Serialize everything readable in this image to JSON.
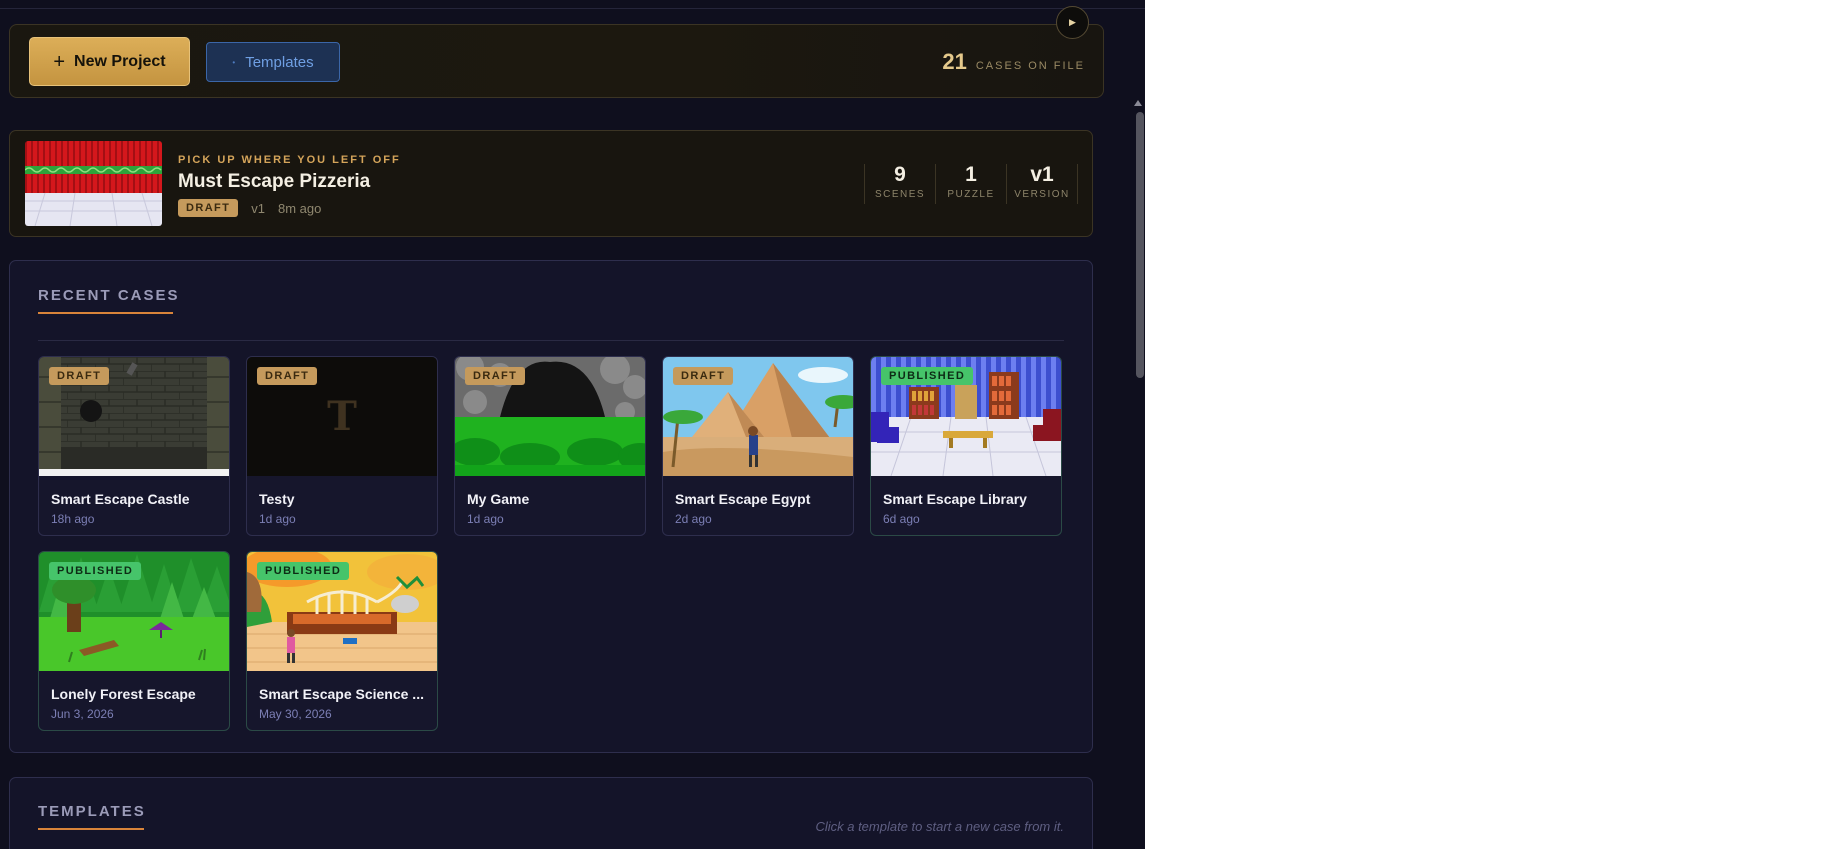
{
  "toolbar": {
    "new_project_label": "New Project",
    "new_project_icon": "plus-icon",
    "templates_label": "Templates",
    "case_count": "21",
    "case_count_label": "CASES ON FILE",
    "play_icon": "play-icon"
  },
  "continue_card": {
    "eyebrow": "PICK UP WHERE YOU LEFT OFF",
    "title": "Must Escape Pizzeria",
    "status": "DRAFT",
    "version": "v1",
    "edited": "8m ago",
    "stats": [
      {
        "value": "9",
        "label": "SCENES"
      },
      {
        "value": "1",
        "label": "PUZZLE"
      },
      {
        "value": "v1",
        "label": "VERSION"
      }
    ]
  },
  "recent": {
    "title": "RECENT CASES",
    "cards": [
      {
        "title": "Smart Escape Castle",
        "time": "18h ago",
        "status": "DRAFT"
      },
      {
        "title": "Testy",
        "time": "1d ago",
        "status": "DRAFT",
        "placeholder_letter": "T"
      },
      {
        "title": "My Game",
        "time": "1d ago",
        "status": "DRAFT"
      },
      {
        "title": "Smart Escape Egypt",
        "time": "2d ago",
        "status": "DRAFT"
      },
      {
        "title": "Smart Escape Library",
        "time": "6d ago",
        "status": "PUBLISHED"
      },
      {
        "title": "Lonely Forest Escape",
        "time": "Jun 3, 2026",
        "status": "PUBLISHED"
      },
      {
        "title": "Smart Escape Science ...",
        "time": "May 30, 2026",
        "status": "PUBLISHED"
      }
    ]
  },
  "templates": {
    "title": "TEMPLATES",
    "hint": "Click a template to start a new case from it."
  },
  "colors": {
    "accent_gold": "#d4a45a",
    "draft_badge": "#c59a5c",
    "published_badge": "#46c46a",
    "panel_bg": "#141429",
    "underline_orange": "#d9843a"
  }
}
